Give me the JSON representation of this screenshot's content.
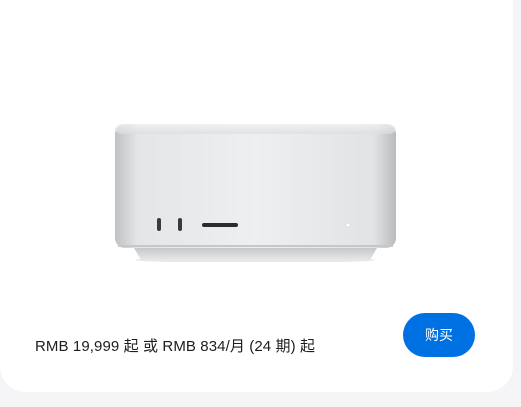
{
  "product": {
    "image_icon": "mac-studio-icon",
    "price_text": "RMB 19,999 起 或 RMB 834/月 (24 期) 起",
    "buy_label": "购买"
  },
  "colors": {
    "accent": "#0071e3",
    "card_bg": "#ffffff",
    "page_bg": "#f5f5f7",
    "text": "#1d1d1f"
  }
}
